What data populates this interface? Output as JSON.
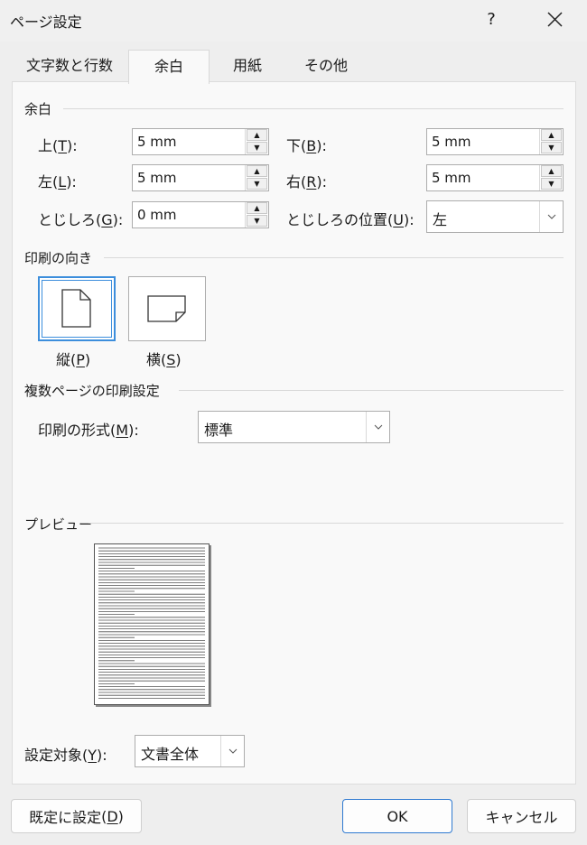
{
  "window": {
    "title": "ページ設定",
    "help": "?"
  },
  "tabs": [
    {
      "label": "文字数と行数",
      "active": false
    },
    {
      "label": "余白",
      "active": true
    },
    {
      "label": "用紙",
      "active": false
    },
    {
      "label": "その他",
      "active": false
    }
  ],
  "margins": {
    "section": "余白",
    "top": {
      "label": "上",
      "key": "T",
      "value": "5 mm"
    },
    "bottom": {
      "label": "下",
      "key": "B",
      "value": "5 mm"
    },
    "left": {
      "label": "左",
      "key": "L",
      "value": "5 mm"
    },
    "right": {
      "label": "右",
      "key": "R",
      "value": "5 mm"
    },
    "gutter": {
      "label": "とじしろ",
      "key": "G",
      "value": "0 mm"
    },
    "gutter_pos": {
      "label": "とじしろの位置",
      "key": "U",
      "value": "左"
    }
  },
  "orientation": {
    "section": "印刷の向き",
    "portrait": {
      "label": "縦",
      "key": "P",
      "selected": true
    },
    "landscape": {
      "label": "横",
      "key": "S",
      "selected": false
    }
  },
  "multipage": {
    "section": "複数ページの印刷設定",
    "format": {
      "label": "印刷の形式",
      "key": "M",
      "value": "標準"
    }
  },
  "preview": {
    "section": "プレビュー"
  },
  "apply_to": {
    "label": "設定対象",
    "key": "Y",
    "value": "文書全体"
  },
  "buttons": {
    "default": {
      "label": "既定に設定",
      "key": "D"
    },
    "ok": "OK",
    "cancel": "キャンセル"
  },
  "colors": {
    "accent": "#3c8edc",
    "panel": "#f9f9f9",
    "window": "#eeeeee"
  }
}
